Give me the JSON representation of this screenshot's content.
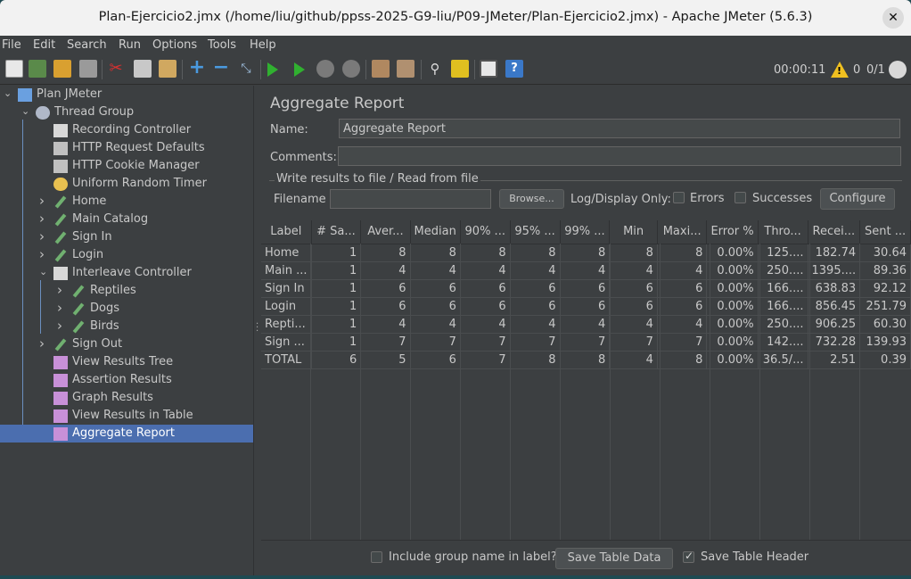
{
  "window": {
    "title": "Plan-Ejercicio2.jmx (/home/liu/github/ppss-2025-G9-liu/P09-JMeter/Plan-Ejercicio2.jmx) - Apache JMeter (5.6.3)"
  },
  "menu": [
    "File",
    "Edit",
    "Search",
    "Run",
    "Options",
    "Tools",
    "Help"
  ],
  "toolbar": {
    "icons": [
      "new-icon",
      "templates-icon",
      "open-icon",
      "save-icon",
      "cut-icon",
      "copy-icon",
      "paste-icon",
      "expand-icon",
      "collapse-icon",
      "toggle-icon",
      "start-icon",
      "start-no-pauses-icon",
      "stop-icon",
      "shutdown-icon",
      "clear-icon",
      "clear-all-icon",
      "search-icon",
      "reset-search-icon",
      "function-helper-icon",
      "help-icon"
    ],
    "timer": "00:00:11",
    "error_count": "0",
    "threads": "0/1"
  },
  "tree": [
    {
      "label": "Plan JMeter",
      "icon": "test-plan-icon",
      "level": 0,
      "arrow": "down"
    },
    {
      "label": "Thread Group",
      "icon": "gear-icon",
      "level": 1,
      "arrow": "down"
    },
    {
      "label": "Recording Controller",
      "icon": "controller-icon",
      "level": 2,
      "arrow": ""
    },
    {
      "label": "HTTP Request Defaults",
      "icon": "wrench-icon",
      "level": 2,
      "arrow": ""
    },
    {
      "label": "HTTP Cookie Manager",
      "icon": "wrench-icon",
      "level": 2,
      "arrow": ""
    },
    {
      "label": "Uniform Random Timer",
      "icon": "timer-icon",
      "level": 2,
      "arrow": ""
    },
    {
      "label": "Home",
      "icon": "sampler-icon",
      "level": 2,
      "arrow": "right"
    },
    {
      "label": "Main Catalog",
      "icon": "sampler-icon",
      "level": 2,
      "arrow": "right"
    },
    {
      "label": "Sign In",
      "icon": "sampler-icon",
      "level": 2,
      "arrow": "right"
    },
    {
      "label": "Login",
      "icon": "sampler-icon",
      "level": 2,
      "arrow": "right"
    },
    {
      "label": "Interleave Controller",
      "icon": "controller-icon",
      "level": 2,
      "arrow": "down"
    },
    {
      "label": "Reptiles",
      "icon": "sampler-icon",
      "level": 3,
      "arrow": "right"
    },
    {
      "label": "Dogs",
      "icon": "sampler-icon",
      "level": 3,
      "arrow": "right"
    },
    {
      "label": "Birds",
      "icon": "sampler-icon",
      "level": 3,
      "arrow": "right"
    },
    {
      "label": "Sign Out",
      "icon": "sampler-icon",
      "level": 2,
      "arrow": "right"
    },
    {
      "label": "View Results Tree",
      "icon": "listener-icon",
      "level": 2,
      "arrow": ""
    },
    {
      "label": "Assertion Results",
      "icon": "listener-icon",
      "level": 2,
      "arrow": ""
    },
    {
      "label": "Graph Results",
      "icon": "listener-icon",
      "level": 2,
      "arrow": ""
    },
    {
      "label": "View Results in Table",
      "icon": "listener-icon",
      "level": 2,
      "arrow": ""
    },
    {
      "label": "Aggregate Report",
      "icon": "listener-icon",
      "level": 2,
      "arrow": "",
      "selected": true
    }
  ],
  "panel": {
    "heading": "Aggregate Report",
    "name_label": "Name:",
    "name_value": "Aggregate Report",
    "comments_label": "Comments:",
    "comments_value": "",
    "fileset_title": "Write results to file / Read from file",
    "filename_label": "Filename",
    "filename_value": "",
    "browse_label": "Browse...",
    "log_display_label": "Log/Display Only:",
    "errors_label": "Errors",
    "successes_label": "Successes",
    "configure_label": "Configure",
    "include_group_label": "Include group name in label?",
    "save_table_data_label": "Save Table Data",
    "save_table_header_label": "Save Table Header"
  },
  "table": {
    "headers": [
      "Label",
      "# Sa...",
      "Aver...",
      "Median",
      "90% ...",
      "95% ...",
      "99% ...",
      "Min",
      "Maxi...",
      "Error %",
      "Thro...",
      "Recei...",
      "Sent ..."
    ],
    "rows": [
      [
        "Home",
        "1",
        "8",
        "8",
        "8",
        "8",
        "8",
        "8",
        "8",
        "0.00%",
        "125....",
        "182.74",
        "30.64"
      ],
      [
        "Main ...",
        "1",
        "4",
        "4",
        "4",
        "4",
        "4",
        "4",
        "4",
        "0.00%",
        "250....",
        "1395....",
        "89.36"
      ],
      [
        "Sign In",
        "1",
        "6",
        "6",
        "6",
        "6",
        "6",
        "6",
        "6",
        "0.00%",
        "166....",
        "638.83",
        "92.12"
      ],
      [
        "Login",
        "1",
        "6",
        "6",
        "6",
        "6",
        "6",
        "6",
        "6",
        "0.00%",
        "166....",
        "856.45",
        "251.79"
      ],
      [
        "Repti...",
        "1",
        "4",
        "4",
        "4",
        "4",
        "4",
        "4",
        "4",
        "0.00%",
        "250....",
        "906.25",
        "60.30"
      ],
      [
        "Sign ...",
        "1",
        "7",
        "7",
        "7",
        "7",
        "7",
        "7",
        "7",
        "0.00%",
        "142....",
        "732.28",
        "139.93"
      ],
      [
        "TOTAL",
        "6",
        "5",
        "6",
        "7",
        "8",
        "8",
        "4",
        "8",
        "0.00%",
        "36.5/...",
        "2.51",
        "0.39"
      ]
    ]
  }
}
